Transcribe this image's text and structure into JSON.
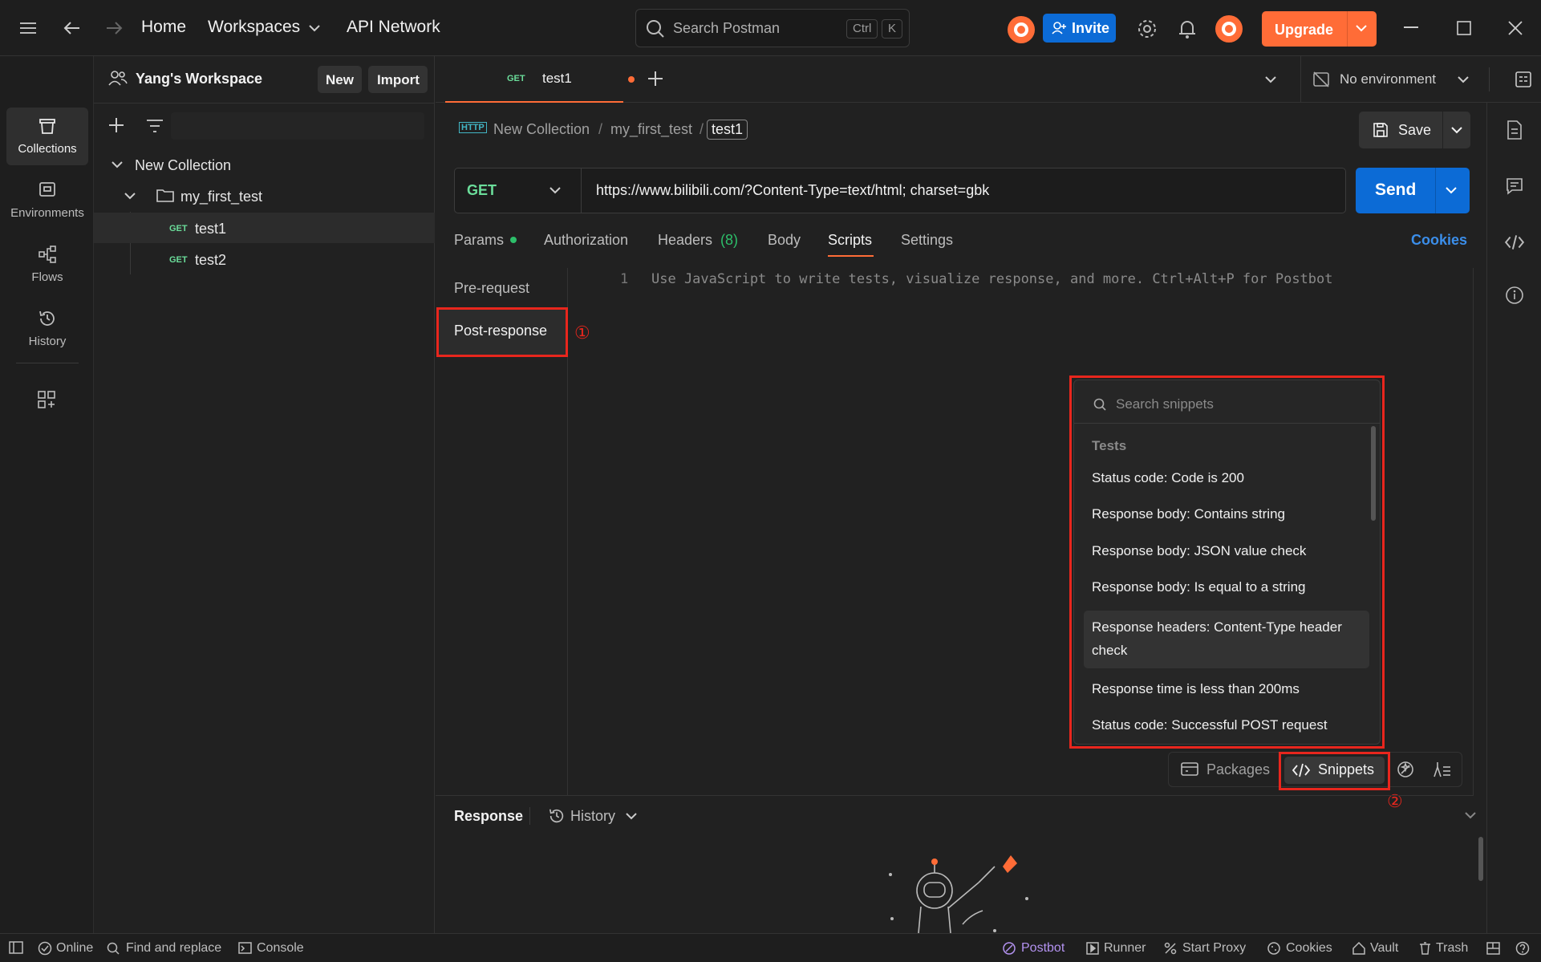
{
  "titlebar": {
    "home": "Home",
    "workspaces": "Workspaces",
    "api_network": "API Network",
    "search_placeholder": "Search Postman",
    "shortcut_ctrl": "Ctrl",
    "shortcut_k": "K",
    "invite": "Invite",
    "upgrade": "Upgrade"
  },
  "workspace": {
    "name": "Yang's Workspace",
    "new_label": "New",
    "import_label": "Import"
  },
  "rail": {
    "items": [
      {
        "label": "Collections"
      },
      {
        "label": "Environments"
      },
      {
        "label": "Flows"
      },
      {
        "label": "History"
      }
    ]
  },
  "tree": {
    "collection": "New Collection",
    "folder": "my_first_test",
    "requests": [
      {
        "method": "GET",
        "name": "test1"
      },
      {
        "method": "GET",
        "name": "test2"
      }
    ]
  },
  "tab": {
    "method": "GET",
    "name": "test1"
  },
  "environment": {
    "label": "No environment"
  },
  "breadcrumb": {
    "http": "HTTP",
    "collection": "New Collection",
    "sep": "/",
    "folder": "my_first_test",
    "request": "test1"
  },
  "save": {
    "label": "Save"
  },
  "request": {
    "method": "GET",
    "url": "https://www.bilibili.com/?Content-Type=text/html; charset=gbk",
    "send": "Send"
  },
  "req_tabs": {
    "params": "Params",
    "authorization": "Authorization",
    "headers": "Headers",
    "headers_count": "(8)",
    "body": "Body",
    "scripts": "Scripts",
    "settings": "Settings",
    "cookies": "Cookies"
  },
  "scripts": {
    "pre_request": "Pre-request",
    "post_response": "Post-response",
    "line_number": "1",
    "editor_placeholder": "Use JavaScript to write tests, visualize response, and more. Ctrl+Alt+P for Postbot"
  },
  "annotations": {
    "marker_1": "①",
    "marker_2": "②"
  },
  "snippets": {
    "search_placeholder": "Search snippets",
    "section": "Tests",
    "items": [
      "Status code: Code is 200",
      "Response body: Contains string",
      "Response body: JSON value check",
      "Response body: Is equal to a string",
      "Response headers: Content-Type header check",
      "Response time is less than 200ms",
      "Status code: Successful POST request"
    ]
  },
  "editor_toolbar": {
    "packages": "Packages",
    "snippets": "Snippets"
  },
  "response": {
    "title": "Response",
    "history": "History"
  },
  "statusbar": {
    "online": "Online",
    "find_replace": "Find and replace",
    "console": "Console",
    "postbot": "Postbot",
    "runner": "Runner",
    "start_proxy": "Start Proxy",
    "cookies": "Cookies",
    "vault": "Vault",
    "trash": "Trash"
  },
  "colors": {
    "accent_orange": "#ff6c37",
    "accent_blue": "#0c6bd6",
    "get_green": "#6bdd9a",
    "annotation_red": "#e8261d"
  }
}
